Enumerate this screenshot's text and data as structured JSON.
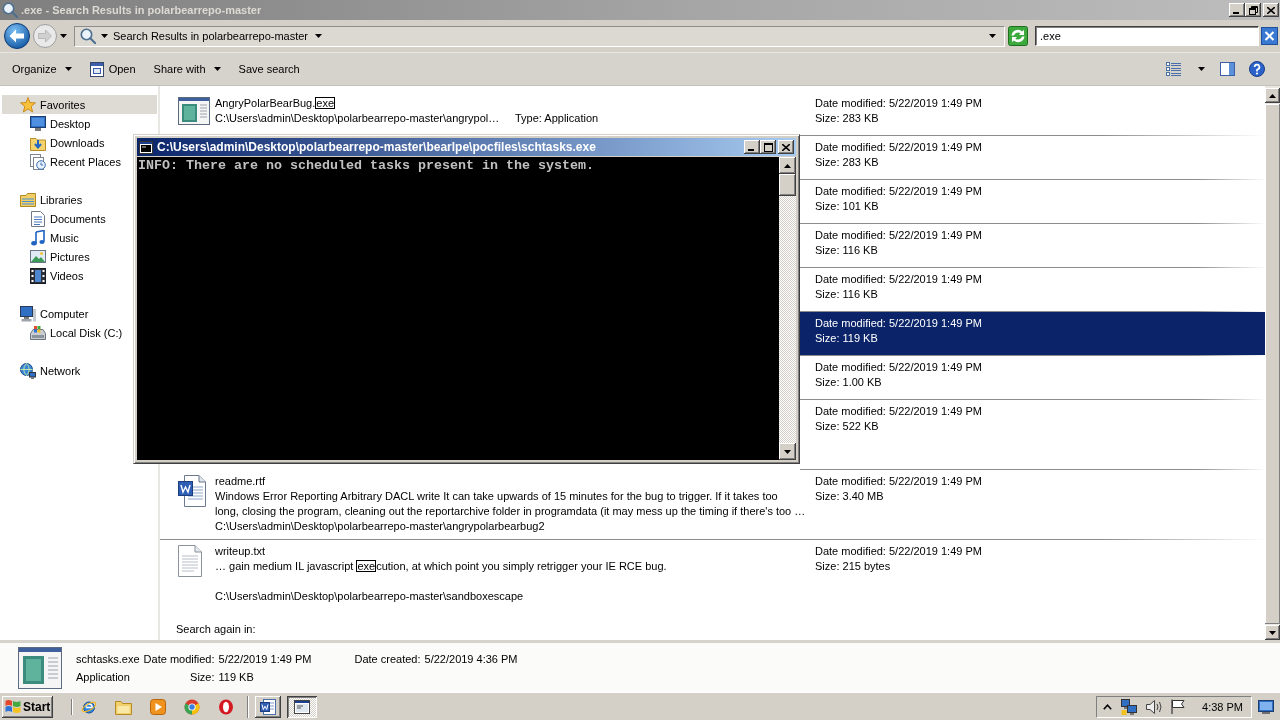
{
  "window": {
    "title": ".exe - Search Results in polarbearrepo-master"
  },
  "address_bar": {
    "breadcrumb": "Search Results in polarbearrepo-master"
  },
  "search": {
    "value": ".exe"
  },
  "toolbar": {
    "items": [
      {
        "label": "Organize",
        "kind": "menu"
      },
      {
        "label": "Open",
        "kind": "icon"
      },
      {
        "label": "Share with",
        "kind": "menu"
      },
      {
        "label": "Save search",
        "kind": "plain"
      }
    ]
  },
  "sidebar": {
    "items": [
      {
        "label": "Favorites",
        "selected": true,
        "children": [
          {
            "label": "Desktop",
            "selected": false
          },
          {
            "label": "Downloads",
            "selected": false
          },
          {
            "label": "Recent Places",
            "selected": false
          }
        ]
      },
      {
        "label": "Libraries",
        "selected": false,
        "children": [
          {
            "label": "Documents",
            "selected": false
          },
          {
            "label": "Music",
            "selected": false
          },
          {
            "label": "Pictures",
            "selected": false
          },
          {
            "label": "Videos",
            "selected": false
          }
        ]
      },
      {
        "label": "Computer",
        "selected": false,
        "children": [
          {
            "label": "Local Disk (C:)",
            "selected": false
          }
        ]
      },
      {
        "label": "Network",
        "selected": false
      }
    ]
  },
  "results": {
    "rows": [
      {
        "kind": "application",
        "selected": false,
        "name": [
          {
            "text": "AngryPolarBearBug.",
            "hit": false
          },
          {
            "text": "exe",
            "hit": true
          }
        ],
        "path": "C:\\Users\\admin\\Desktop\\polarbearrepo-master\\angrypol…",
        "type": "Type: Application",
        "date_modified": "Date modified: 5/22/2019 1:49 PM",
        "size": "Size: 283 KB"
      },
      {
        "kind": "application",
        "selected": false,
        "date_modified": "Date modified: 5/22/2019 1:49 PM",
        "size": "Size: 283 KB"
      },
      {
        "kind": "application",
        "selected": false,
        "date_modified": "Date modified: 5/22/2019 1:49 PM",
        "size": "Size: 101 KB"
      },
      {
        "kind": "application",
        "selected": false,
        "date_modified": "Date modified: 5/22/2019 1:49 PM",
        "size": "Size: 116 KB"
      },
      {
        "kind": "application",
        "selected": false,
        "date_modified": "Date modified: 5/22/2019 1:49 PM",
        "size": "Size: 116 KB"
      },
      {
        "kind": "application",
        "selected": true,
        "date_modified": "Date modified: 5/22/2019 1:49 PM",
        "size": "Size: 119 KB"
      },
      {
        "kind": "application",
        "selected": false,
        "date_modified": "Date modified: 5/22/2019 1:49 PM",
        "size": "Size: 1.00 KB"
      },
      {
        "kind": "document",
        "selected": false,
        "date_modified": "Date modified: 5/22/2019 1:49 PM",
        "size": "Size: 522 KB"
      },
      {
        "kind": "document",
        "selected": false,
        "name": [
          {
            "text": "readme.rtf",
            "hit": false
          }
        ],
        "snippet": [
          {
            "parts": [
              {
                "text": "Windows Error Reporting Arbitrary DACL write It can take upwards of 15 minutes for the bug to trigger. If it takes too",
                "hit": false
              }
            ]
          },
          {
            "parts": [
              {
                "text": "long, closing the program, cleaning out the reportarchive folder in programdata (it may mess up the timing if there's too …",
                "hit": false
              }
            ]
          }
        ],
        "path": "C:\\Users\\admin\\Desktop\\polarbearrepo-master\\angrypolarbearbug2",
        "date_modified": "Date modified: 5/22/2019 1:49 PM",
        "size": "Size: 3.40 MB"
      },
      {
        "kind": "text",
        "selected": false,
        "name": [
          {
            "text": "writeup.txt",
            "hit": false
          }
        ],
        "snippet": [
          {
            "parts": [
              {
                "text": "… gain medium IL javascript ",
                "hit": false
              },
              {
                "text": "exe",
                "hit": true
              },
              {
                "text": "cution, at which point you simply retrigger your IE RCE bug.",
                "hit": false
              }
            ]
          }
        ],
        "path": "C:\\Users\\admin\\Desktop\\polarbearrepo-master\\sandboxescape",
        "date_modified": "Date modified: 5/22/2019 1:49 PM",
        "size": "Size: 215 bytes"
      }
    ],
    "search_again": "Search again in:"
  },
  "console": {
    "title": "C:\\Users\\admin\\Desktop\\polarbearrepo-master\\bearlpe\\pocfiles\\schtasks.exe",
    "lines": [
      "INFO: There are no scheduled tasks present in the system."
    ]
  },
  "details": {
    "name": "schtasks.exe",
    "type": "Application",
    "fields": [
      {
        "label": "Date modified:",
        "value": "5/22/2019 1:49 PM"
      },
      {
        "label": "Size:",
        "value": "119 KB"
      },
      {
        "label": "Date created:",
        "value": "5/22/2019 4:36 PM"
      }
    ]
  },
  "taskbar": {
    "start": "Start",
    "tasks": [
      {
        "selected": false
      },
      {
        "selected": true
      }
    ],
    "clock": "4:38 PM"
  }
}
